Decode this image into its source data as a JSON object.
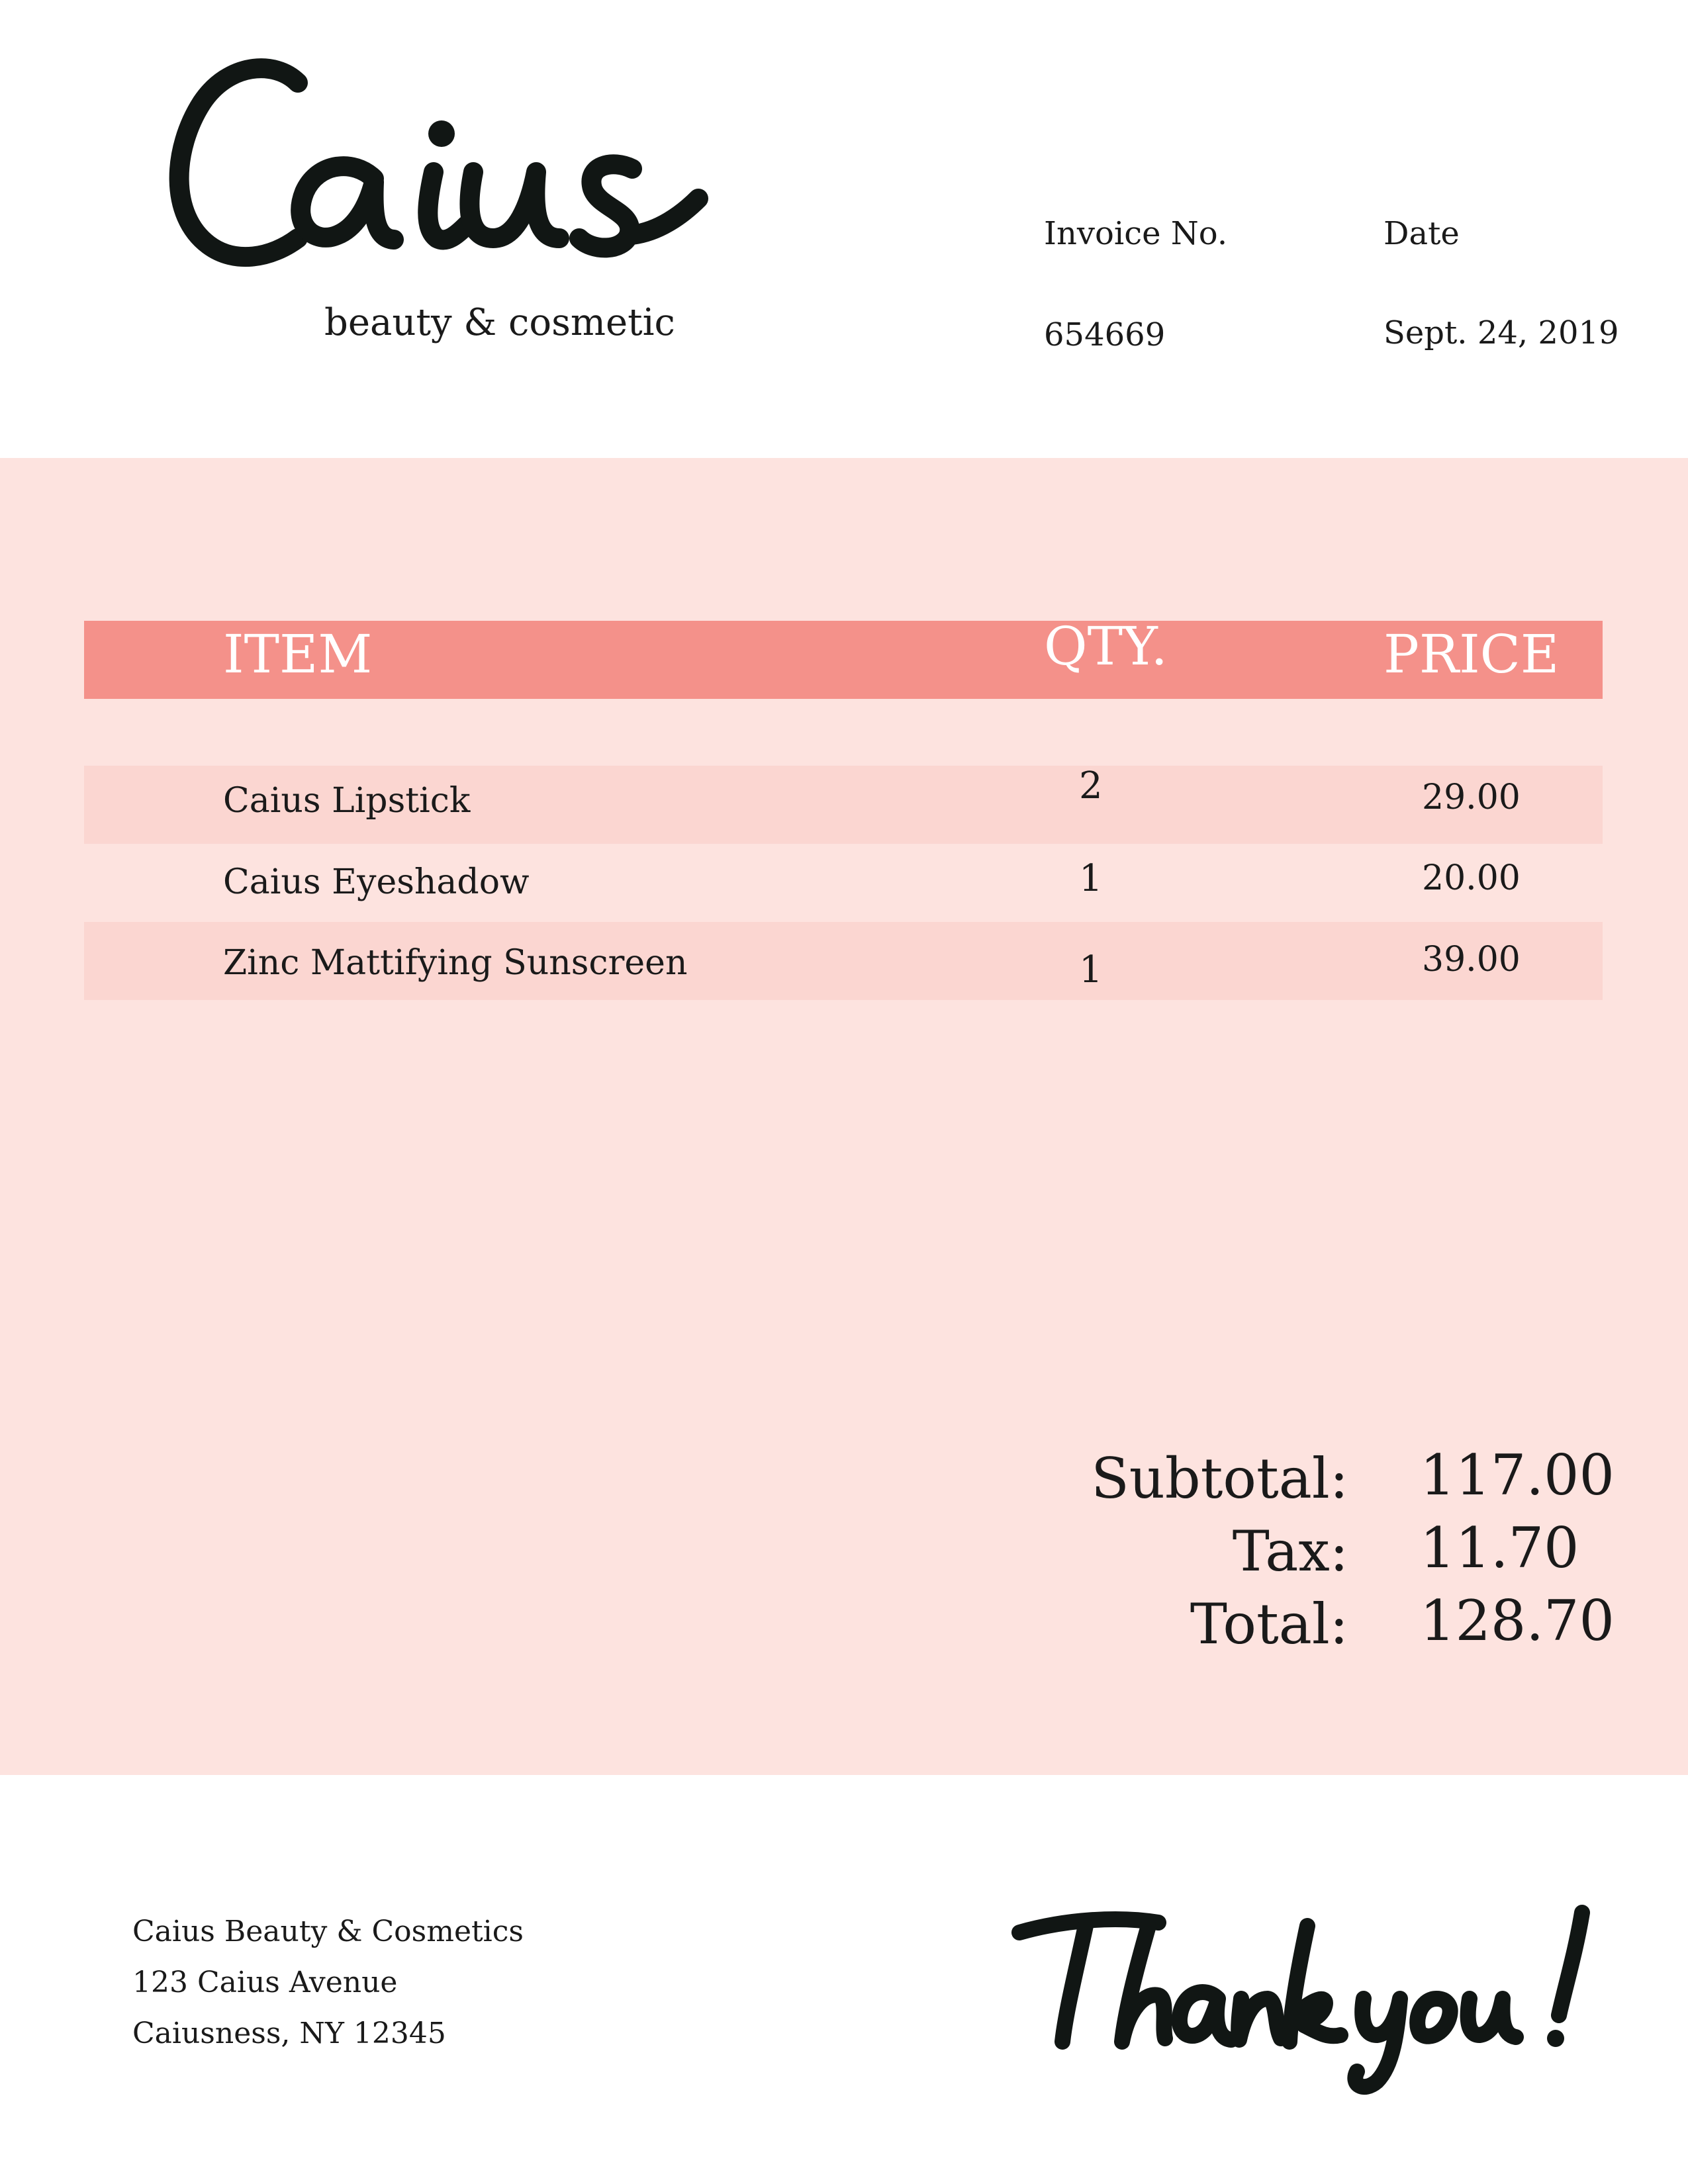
{
  "brand": {
    "name": "Caius",
    "tagline": "beauty & cosmetic"
  },
  "invoice": {
    "number_label": "Invoice No.",
    "number": "654669",
    "date_label": "Date",
    "date": "Sept. 24, 2019"
  },
  "table": {
    "headers": {
      "item": "ITEM",
      "qty": "QTY.",
      "price": "PRICE"
    },
    "rows": [
      {
        "item": "Caius Lipstick",
        "qty": "2",
        "price": "29.00"
      },
      {
        "item": "Caius Eyeshadow",
        "qty": "1",
        "price": "20.00"
      },
      {
        "item": "Zinc Mattifying Sunscreen",
        "qty": "1",
        "price": "39.00"
      }
    ]
  },
  "totals": {
    "subtotal_label": "Subtotal:",
    "subtotal": "117.00",
    "tax_label": "Tax:",
    "tax": "11.70",
    "total_label": "Total:",
    "total": "128.70"
  },
  "footer": {
    "company": "Caius Beauty & Cosmetics",
    "street": "123 Caius Avenue",
    "city": "Caiusness, NY 12345",
    "thanks": "Thank you!"
  },
  "colors": {
    "panel": "#fde3df",
    "header_bar": "#f4918a",
    "row_shade": "#fbd6d1",
    "text": "#1a1a1a"
  }
}
